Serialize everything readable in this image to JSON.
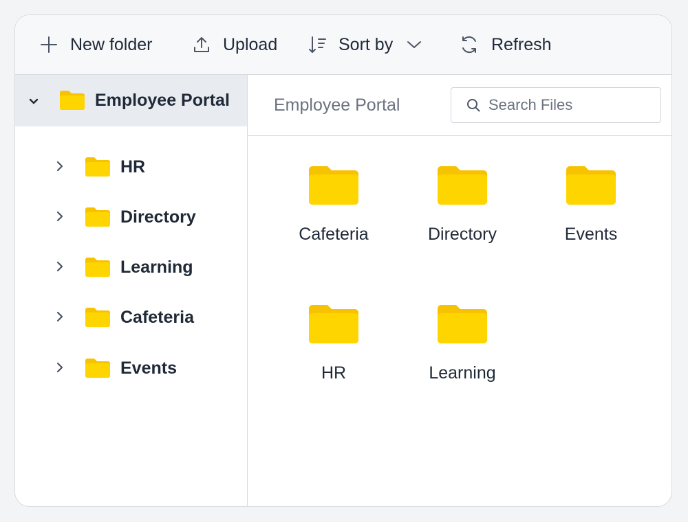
{
  "toolbar": {
    "new_folder": "New folder",
    "upload": "Upload",
    "sort_by": "Sort by",
    "refresh": "Refresh"
  },
  "tree": {
    "root": "Employee Portal",
    "children": [
      "HR",
      "Directory",
      "Learning",
      "Cafeteria",
      "Events"
    ]
  },
  "main": {
    "breadcrumb": "Employee Portal",
    "search_placeholder": "Search Files",
    "items": [
      "Cafeteria",
      "Directory",
      "Events",
      "HR",
      "Learning"
    ]
  },
  "colors": {
    "folder": "#FFD500",
    "folder_tab": "#F7C300",
    "selected_bg": "#E8EBEF"
  },
  "icons": [
    "plus-icon",
    "upload-icon",
    "sort-icon",
    "chevron-down-icon",
    "refresh-icon",
    "folder-icon",
    "chevron-right-icon",
    "search-icon"
  ]
}
